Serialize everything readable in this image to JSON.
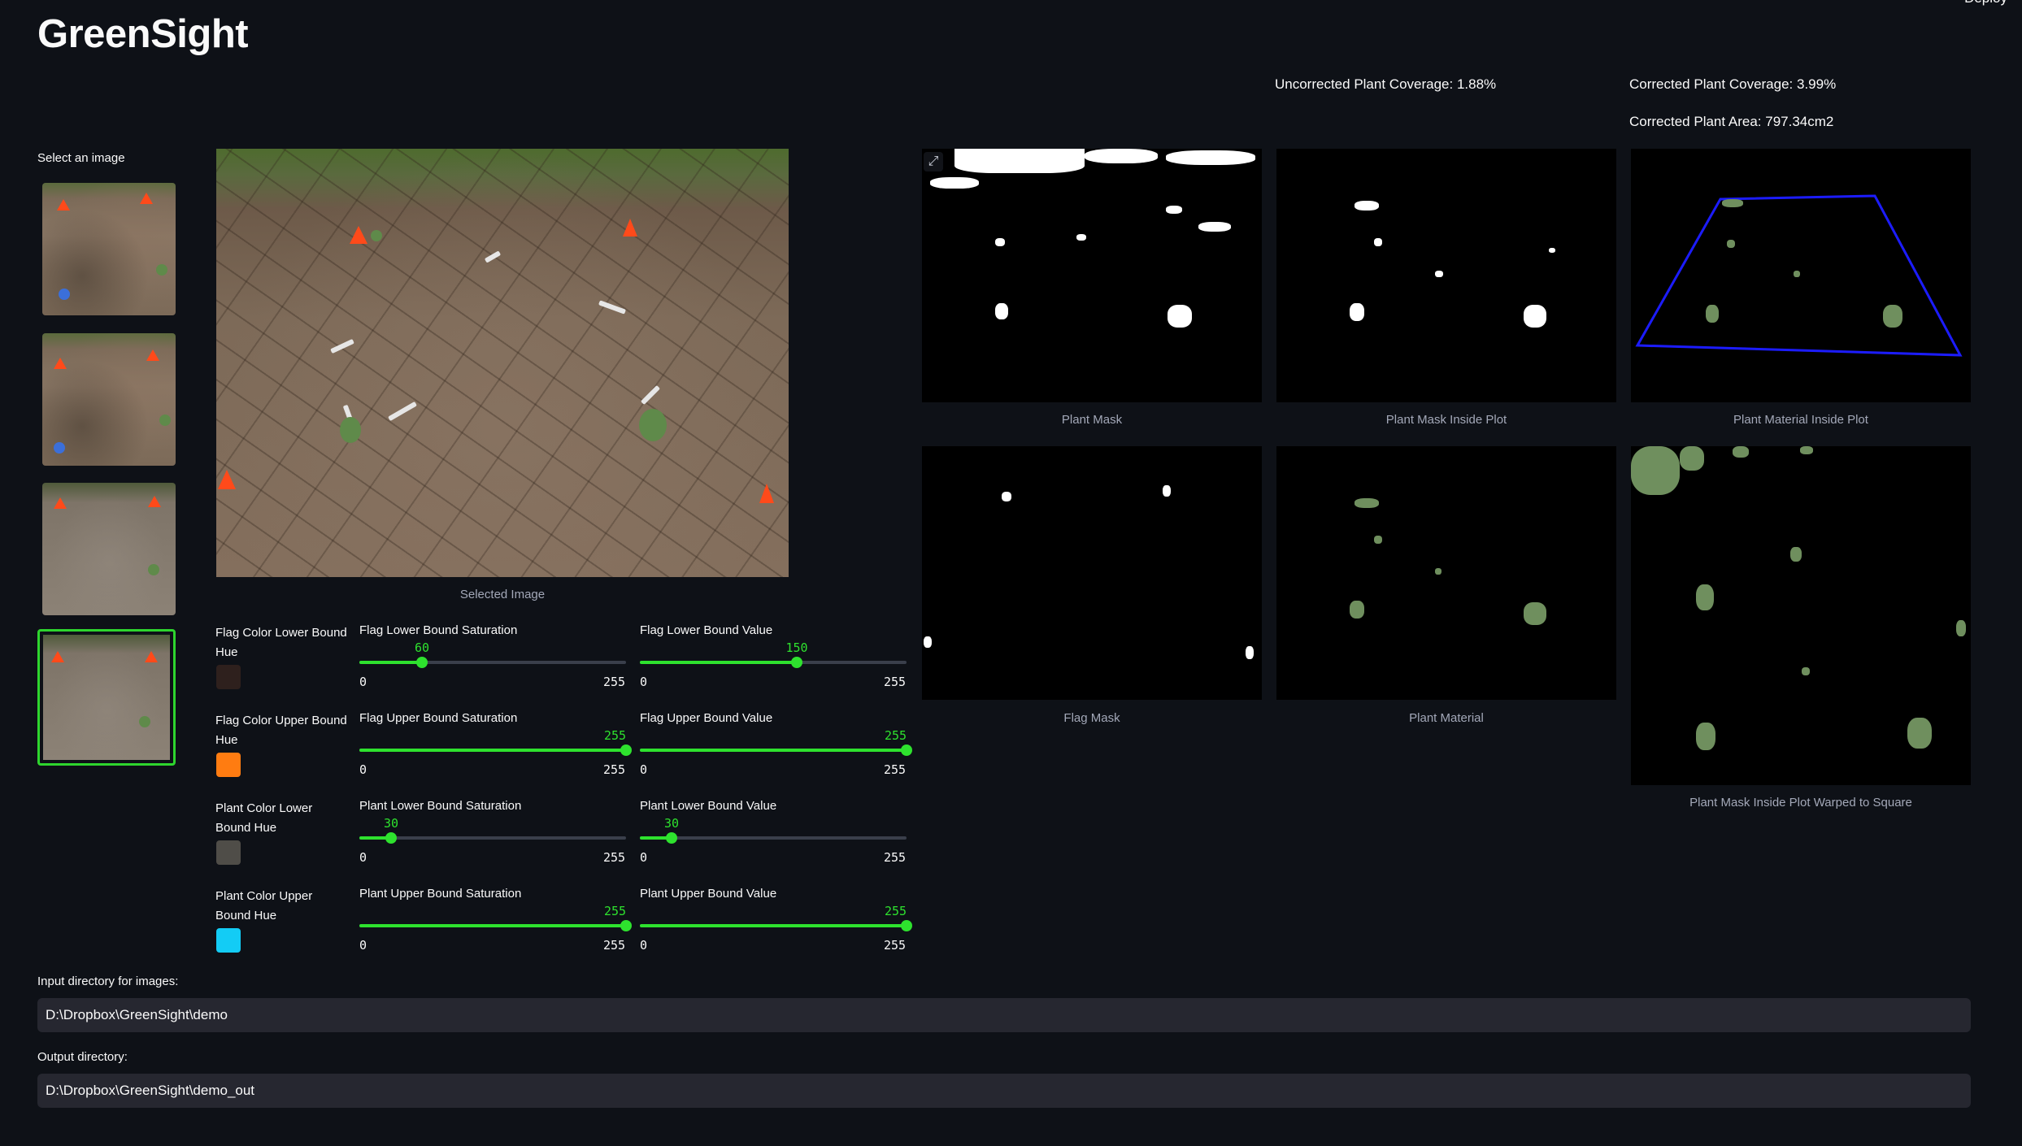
{
  "app": {
    "title": "GreenSight",
    "deploy_label": "Deploy"
  },
  "stats": {
    "uncorrected_coverage": "Uncorrected Plant Coverage: 1.88%",
    "corrected_coverage": "Corrected Plant Coverage: 3.99%",
    "corrected_area": "Corrected Plant Area: 797.34cm2"
  },
  "sidebar": {
    "select_label": "Select an image",
    "selected_index": 3
  },
  "main_image": {
    "caption": "Selected Image"
  },
  "results": {
    "captions": [
      "Plant Mask",
      "Plant Mask Inside Plot",
      "Plant Material Inside Plot",
      "Flag Mask",
      "Plant Material",
      "Plant Mask Inside Plot Warped to Square"
    ],
    "expand_icon": "expand-icon"
  },
  "color_pickers": [
    {
      "label": "Flag Color Lower Bound Hue",
      "color": "#2e201d"
    },
    {
      "label": "Flag Color Upper Bound Hue",
      "color": "#ff7c11"
    },
    {
      "label": "Plant Color Lower Bound Hue",
      "color": "#4f4d48"
    },
    {
      "label": "Plant Color Upper Bound Hue",
      "color": "#13ccf5"
    }
  ],
  "sliders": [
    {
      "label": "Flag Lower Bound Saturation",
      "value": "60",
      "min": "0",
      "max": "255"
    },
    {
      "label": "Flag Lower Bound Value",
      "value": "150",
      "min": "0",
      "max": "255"
    },
    {
      "label": "Flag Upper Bound Saturation",
      "value": "255",
      "min": "0",
      "max": "255"
    },
    {
      "label": "Flag Upper Bound Value",
      "value": "255",
      "min": "0",
      "max": "255"
    },
    {
      "label": "Plant Lower Bound Saturation",
      "value": "30",
      "min": "0",
      "max": "255"
    },
    {
      "label": "Plant Lower Bound Value",
      "value": "30",
      "min": "0",
      "max": "255"
    },
    {
      "label": "Plant Upper Bound Saturation",
      "value": "255",
      "min": "0",
      "max": "255"
    },
    {
      "label": "Plant Upper Bound Value",
      "value": "255",
      "min": "0",
      "max": "255"
    }
  ],
  "inputs": {
    "input_dir_label": "Input directory for images:",
    "input_dir_value": "D:\\Dropbox\\GreenSight\\demo",
    "output_dir_label": "Output directory:",
    "output_dir_value": "D:\\Dropbox\\GreenSight\\demo_out"
  },
  "colors": {
    "accent": "#2ee22e",
    "background": "#0e1117",
    "input_bg": "#262730"
  }
}
